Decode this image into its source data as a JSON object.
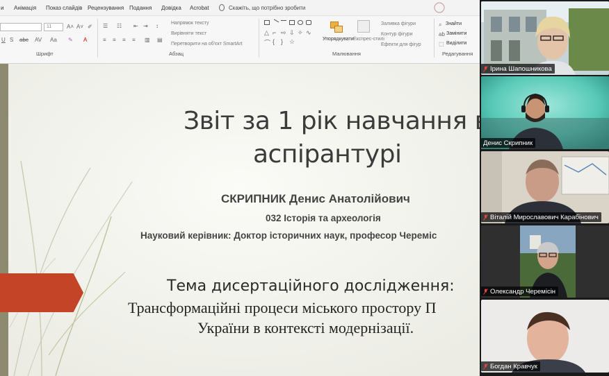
{
  "ribbon": {
    "tabs": [
      "и",
      "Анімація",
      "Показ слайдів",
      "Рецензування",
      "Подання",
      "Довідка",
      "Acrobat",
      "Скажіть, що потрібно зробити"
    ],
    "font_size_value": "11",
    "paragraph_controls": [
      "Напрямок тексту",
      "Вирівняти текст",
      "Перетворити на об'єкт SmartArt"
    ],
    "drawing_controls": [
      "Упорядкувати",
      "Експрес-стилі",
      "Заливка фігури",
      "Контур фігури",
      "Ефекти для фігур"
    ],
    "editing_controls": [
      "Знайти",
      "Замінити",
      "Виділити"
    ],
    "groups": {
      "font": "Шрифт",
      "paragraph": "Абзац",
      "drawing": "Малювання",
      "editing": "Редагування"
    }
  },
  "slide": {
    "title_line1": "Звіт за 1 рік навчання в",
    "title_line2": "аспірантурі",
    "author": "СКРИПНИК Денис Анатолійович",
    "speciality": "032 Історія та археологія",
    "supervisor": "Науковий керівник: Доктор історичних наук, професор Череміс",
    "topic_label": "Тема дисертаційного дослідження:",
    "topic_line1": "Трансформаційні процеси міського простору П",
    "topic_line2": "України в контексті модернізації."
  },
  "participants": [
    {
      "name": "Ірина Шапошникова",
      "active": false,
      "muted": true
    },
    {
      "name": "Денис Скрипник",
      "active": true,
      "muted": false
    },
    {
      "name": "Віталій Мирославович Карабінович",
      "active": false,
      "muted": true
    },
    {
      "name": "Олександр Черемісін",
      "active": false,
      "muted": true
    },
    {
      "name": "Богдан Кравчук",
      "active": false,
      "muted": true
    }
  ],
  "colors": {
    "accent_red": "#c44427",
    "active_speaker": "#3fce5f",
    "slide_bg": "#f7f7f3",
    "slide_bar": "#8e8a70"
  }
}
